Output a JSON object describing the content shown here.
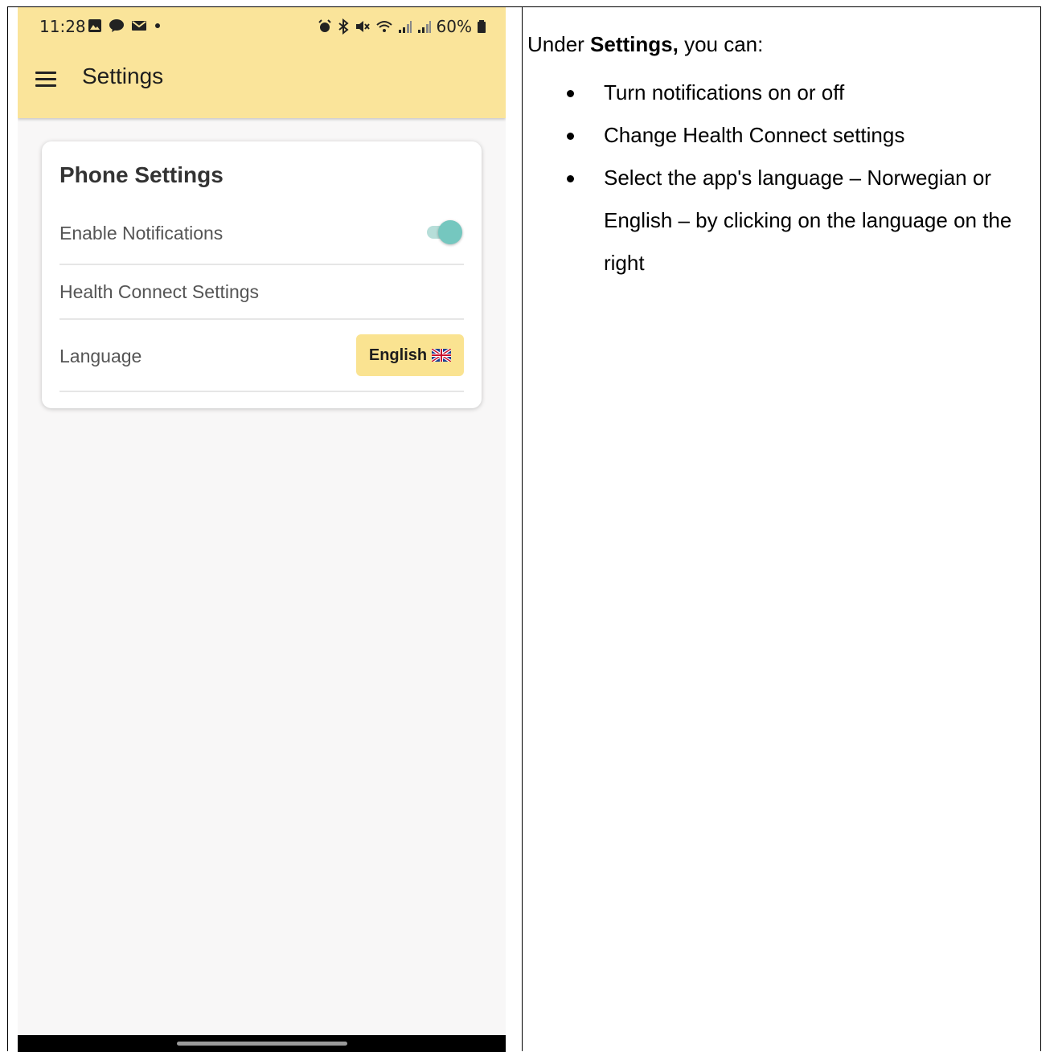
{
  "status_bar": {
    "time": "11:28",
    "battery": "60%",
    "left_icons": [
      "gallery-icon",
      "chat-icon",
      "mail-icon",
      "dot-icon"
    ],
    "right_icons": [
      "alarm-icon",
      "bluetooth-icon",
      "mute-icon",
      "wifi-icon",
      "signal-icon",
      "signal-icon",
      "battery-icon"
    ]
  },
  "appbar": {
    "title": "Settings"
  },
  "card": {
    "title": "Phone Settings",
    "notifications_label": "Enable Notifications",
    "notifications_enabled": true,
    "health_label": "Health Connect Settings",
    "language_label": "Language",
    "language_button": "English"
  },
  "instructions": {
    "intro_prefix": "Under ",
    "intro_bold": "Settings,",
    "intro_suffix": " you can:",
    "bullets": [
      "Turn notifications on or off",
      "Change Health Connect settings",
      "Select the app's language – Norwegian or English – by clicking on the language on the right"
    ]
  },
  "colors": {
    "appbar": "#fae49a",
    "toggle_accent": "#75c7bf",
    "language_button": "#fae391"
  }
}
